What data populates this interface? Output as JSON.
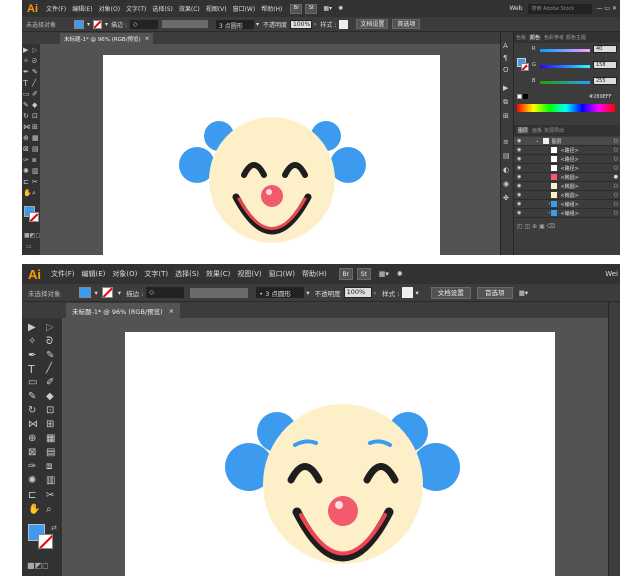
{
  "app": {
    "logo": "Ai"
  },
  "menu": [
    "文件(F)",
    "编辑(E)",
    "对象(O)",
    "文字(T)",
    "选择(S)",
    "效果(C)",
    "视图(V)",
    "窗口(W)",
    "帮助(H)"
  ],
  "bridge_icons": [
    "Br",
    "St"
  ],
  "workspace": "Web",
  "search_placeholder": "搜索 Adobe Stock",
  "control": {
    "selection": "未选择对象",
    "stroke_label": "描边 :",
    "brush": "3 点圆形",
    "opacity_label": "不透明度",
    "opacity_value": "100%",
    "style_label": "样式 :",
    "doc_setup": "文档设置",
    "preferences": "首选项"
  },
  "document_tab": {
    "label": "未标题-1* @ 96% (RGB/预览)",
    "close": "×"
  },
  "color_panel": {
    "tabs": [
      "色板",
      "颜色",
      "色彩参考",
      "颜色主题"
    ],
    "channels": [
      {
        "label": "R",
        "value": "40"
      },
      {
        "label": "G",
        "value": "158"
      },
      {
        "label": "B",
        "value": "255"
      }
    ],
    "hex": "289EFF"
  },
  "layers_panel": {
    "tabs": [
      "图层",
      "画板",
      "资源导出"
    ],
    "parent": "图层",
    "items": [
      "<路径>",
      "<路径>",
      "<路径>",
      "<椭圆>",
      "<椭圆>",
      "<椭圆>",
      "<编组>",
      "<编组>"
    ]
  },
  "colors": {
    "accent_blue": "#3d9bef",
    "face": "#fdf0c8",
    "nose": "#f25a6e",
    "mouth_red": "#ef4452",
    "eye_dark": "#1e1e1e"
  }
}
